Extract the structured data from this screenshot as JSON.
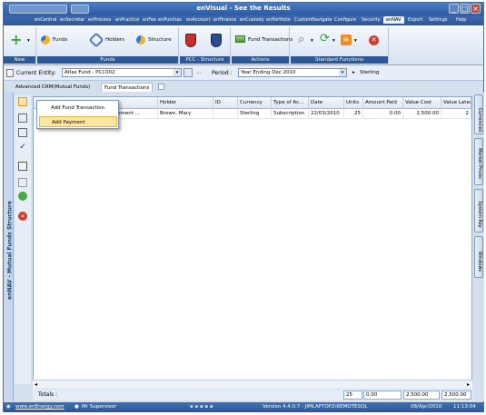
{
  "window": {
    "title": "enVisual - See the Results"
  },
  "menu": [
    "enCentral",
    "enSecretar",
    "enProcess",
    "enPractice",
    "enFee",
    "enPurchas",
    "enAccount",
    "enFinance",
    "enCustody",
    "enPortfolio",
    "Custom",
    "Navigate",
    "Configure",
    "Security",
    "enNAV",
    "Export",
    "Settings",
    "Help"
  ],
  "menu_active": "enNAV",
  "ribbon": {
    "funds_label": "Funds",
    "holders_label": "Holders",
    "structure_label": "Structure",
    "fund_transactions_label": "Fund Transactions",
    "groups": {
      "new": "New",
      "funds": "Funds",
      "pcc": "PCC - Structure",
      "actions": "Actions",
      "standard": "Standard Functions"
    }
  },
  "entity": {
    "label": "Current Entity:",
    "value": "Atlas Fund - PCC002",
    "dots": "...",
    "period_label": "Period :",
    "period_value": "Year Ending Dec 2010",
    "currency": "Sterling"
  },
  "tabs": [
    "Advanced CRM(Mutual Funds)",
    "Fund Transactions"
  ],
  "left_title": "enNAV - Mutual Funds Structure",
  "popup": {
    "items": [
      "Add Fund Transaction",
      "Add Payment"
    ]
  },
  "grid": {
    "columns": [
      "Holder",
      "ID",
      "Currency",
      "Type of Ac...",
      "Date",
      "Units",
      "Amount Paid",
      "Value Cost",
      "Value Latest"
    ],
    "row": {
      "fund": "...ementary Management ...",
      "holder": "Brown, Mary",
      "id": "",
      "currency": "Sterling",
      "type": "Subscription",
      "date": "22/03/2010",
      "units": "25",
      "amount_paid": "0.00",
      "value_cost": "2,500.00",
      "value_latest": "2"
    }
  },
  "totals": {
    "label": "Totals :",
    "units": "25",
    "amount_paid": "0.00",
    "value_cost": "2,500.00",
    "value_latest": "2,500.00"
  },
  "right_tabs": [
    "Currencies",
    "Market Prices",
    "System Key",
    "Windows"
  ],
  "status": {
    "website": "www.enEnergy.com",
    "user": "Mr Supervisor",
    "version": "Version 4.4.0.7 - JIMLAPTOP2\\REMOTESQL",
    "date": "08/Apr/2010",
    "time": "11:13:04"
  },
  "colors": {
    "title_bar": "#2a5aa3",
    "ribbon_group_label": "#2d5796",
    "status_bar": "#2b5797"
  }
}
